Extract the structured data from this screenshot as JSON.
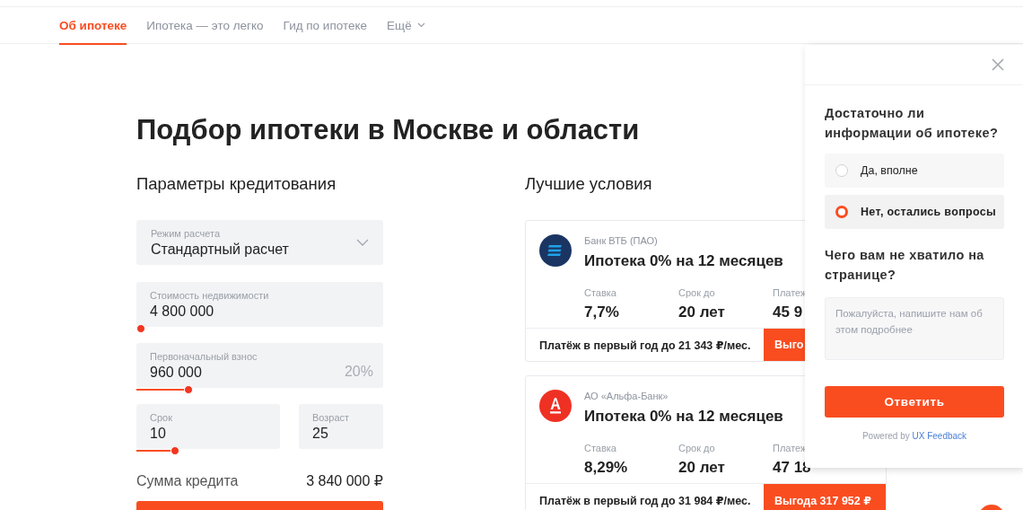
{
  "nav": {
    "items": [
      {
        "label": "Об ипотеке",
        "selected": true,
        "has_menu": false
      },
      {
        "label": "Ипотека — это легко",
        "selected": false,
        "has_menu": false
      },
      {
        "label": "Гид по ипотеке",
        "selected": false,
        "has_menu": false
      },
      {
        "label": "Ещё",
        "selected": false,
        "has_menu": true
      }
    ]
  },
  "page_title": "Подбор ипотеки в Москве и области",
  "calculator": {
    "title": "Параметры кредитования",
    "mode": {
      "label": "Режим расчета",
      "value": "Стандартный расчет"
    },
    "property_price": {
      "label": "Стоимость недвижимости",
      "value": "4 800 000",
      "level": 0
    },
    "down_payment": {
      "label": "Первоначальный взнос",
      "value": "960 000",
      "suffix": "20%",
      "level": 0.2
    },
    "term": {
      "label": "Срок",
      "value": "10",
      "level": 0.25
    },
    "age": {
      "label": "Возраст",
      "value": "25"
    },
    "sum": {
      "label": "Сумма кредита",
      "value": "3 840 000 ₽"
    }
  },
  "offers": {
    "title": "Лучшие условия",
    "items": [
      {
        "kind": "vtb",
        "bank": "Банк ВТБ (ПАО)",
        "title": "Ипотека 0% на 12 месяцев",
        "stats": [
          {
            "label": "Ставка",
            "value": "7,7%"
          },
          {
            "label": "Срок до",
            "value": "20 лет"
          },
          {
            "label": "Платеж",
            "value": "45 9"
          }
        ],
        "note": "Платёж в первый год до 21 343 ₽/мес.",
        "benefit": "Выго"
      },
      {
        "kind": "alfa",
        "bank": "АО «Альфа-Банк»",
        "title": "Ипотека 0% на 12 месяцев",
        "stats": [
          {
            "label": "Ставка",
            "value": "8,29%"
          },
          {
            "label": "Срок до",
            "value": "20 лет"
          },
          {
            "label": "Платеж",
            "value": "47 18"
          }
        ],
        "note": "Платёж в первый год до 31 984 ₽/мес.",
        "benefit": "Выгода 317 952 ₽"
      }
    ]
  },
  "feedback": {
    "question": "Достаточно ли информации об ипотеке?",
    "options": [
      {
        "label": "Да, вполне",
        "selected": false
      },
      {
        "label": "Нет, остались вопросы",
        "selected": true
      }
    ],
    "question_2": "Чего вам не хватило на странице?",
    "placeholder": "Пожалуйста, напишите нам об этом подробнее",
    "submit": "Ответить",
    "powered_by": "Powered by",
    "powered_link": "UX Feedback"
  }
}
